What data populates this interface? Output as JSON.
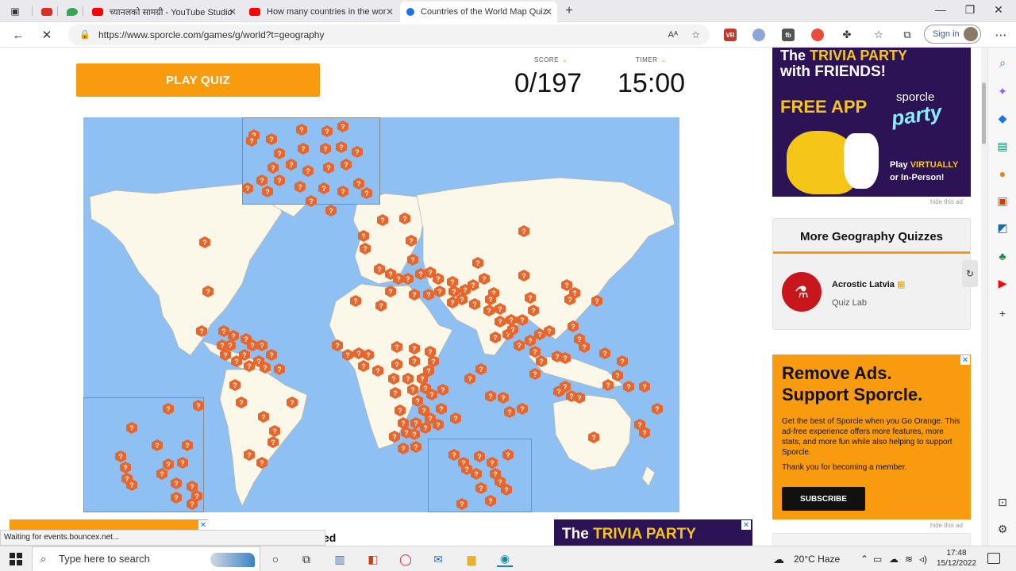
{
  "browser": {
    "tabs": [
      {
        "title": "",
        "icon_color": "#d93025"
      },
      {
        "title": "",
        "icon_color": "#34a853"
      },
      {
        "title": "च्यानलको सामग्री - YouTube Studio",
        "icon_color": "#ff0000"
      },
      {
        "title": "How many countries in the world",
        "icon_color": "#ff0000"
      },
      {
        "title": "Countries of the World Map Quiz",
        "icon_color": "#1a73e8"
      }
    ],
    "new_tab_symbol": "+",
    "close_symbol": "✕",
    "url": "https://www.sporcle.com/games/g/world?t=geography",
    "signin_label": "Sign in",
    "extensions": [
      "VR",
      "fb"
    ]
  },
  "quiz": {
    "play_label": "PLAY QUIZ",
    "score_label": "SCORE",
    "score_value": "0/197",
    "timer_label": "TIMER",
    "timer_value": "15:00",
    "pin_symbol": "?"
  },
  "ads": {
    "top": {
      "line1_a": "The ",
      "line1_b": "TRIVIA PARTY",
      "line2": "with FRIENDS!",
      "free_app": "FREE APP",
      "brand": "sporcle",
      "party": "party",
      "play_a": "Play ",
      "play_b": "VIRTUALLY",
      "play2": "or In-Person!"
    },
    "hide_label": "hide this ad",
    "orange": {
      "headline1": "Remove Ads.",
      "headline2": "Support Sporcle.",
      "body": "Get the best of Sporcle when you Go Orange. This ad-free experience offers more features, more stats, and more fun while also helping to support Sporcle.",
      "thanks": "Thank you for becoming a member.",
      "subscribe": "SUBSCRIBE"
    },
    "bottom_center_a": "The ",
    "bottom_center_b": "TRIVIA PARTY"
  },
  "sidebar_box": {
    "title": "More Geography Quizzes",
    "quiz_title": "Acrostic Latvia",
    "quiz_sub": "Quiz Lab"
  },
  "partial_text": "ed",
  "status_text": "Waiting for events.bouncex.net...",
  "taskbar": {
    "search_placeholder": "Type here to search",
    "weather": "20°C  Haze",
    "time": "17:48",
    "date": "15/12/2022"
  },
  "colors": {
    "accent_orange": "#f89b0f",
    "ocean": "#8ec0f3",
    "land": "#fbf8ea",
    "pin": "#e8652c",
    "ad_purple": "#2b1356"
  }
}
